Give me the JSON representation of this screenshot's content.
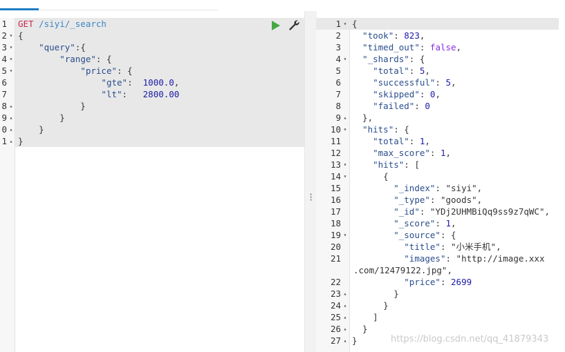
{
  "tab": {
    "underline_color": "#1a7cc4"
  },
  "request": {
    "lines": [
      {
        "n": "1",
        "fold": "",
        "tokens": [
          {
            "t": "GET",
            "c": "method"
          },
          {
            "t": " /siyi/_search",
            "c": "url"
          }
        ]
      },
      {
        "n": "2",
        "fold": "▾",
        "tokens": [
          {
            "t": "{",
            "c": "punc"
          }
        ]
      },
      {
        "n": "3",
        "fold": "▾",
        "tokens": [
          {
            "t": "    ",
            "c": "punc"
          },
          {
            "t": "\"query\"",
            "c": "key"
          },
          {
            "t": ":{",
            "c": "punc"
          }
        ]
      },
      {
        "n": "4",
        "fold": "▾",
        "tokens": [
          {
            "t": "        ",
            "c": "punc"
          },
          {
            "t": "\"range\"",
            "c": "key"
          },
          {
            "t": ": {",
            "c": "punc"
          }
        ]
      },
      {
        "n": "5",
        "fold": "▾",
        "tokens": [
          {
            "t": "            ",
            "c": "punc"
          },
          {
            "t": "\"price\"",
            "c": "key"
          },
          {
            "t": ": {",
            "c": "punc"
          }
        ]
      },
      {
        "n": "6",
        "fold": "",
        "tokens": [
          {
            "t": "                ",
            "c": "punc"
          },
          {
            "t": "\"gte\"",
            "c": "key"
          },
          {
            "t": ":  ",
            "c": "punc"
          },
          {
            "t": "1000.0",
            "c": "num"
          },
          {
            "t": ",",
            "c": "punc"
          }
        ]
      },
      {
        "n": "7",
        "fold": "",
        "tokens": [
          {
            "t": "                ",
            "c": "punc"
          },
          {
            "t": "\"lt\"",
            "c": "key"
          },
          {
            "t": ":   ",
            "c": "punc"
          },
          {
            "t": "2800.00",
            "c": "num"
          }
        ]
      },
      {
        "n": "8",
        "fold": "▴",
        "tokens": [
          {
            "t": "            }",
            "c": "punc"
          }
        ]
      },
      {
        "n": "9",
        "fold": "▴",
        "tokens": [
          {
            "t": "        }",
            "c": "punc"
          }
        ]
      },
      {
        "n": "0",
        "fold": "▴",
        "tokens": [
          {
            "t": "    }",
            "c": "punc"
          }
        ]
      },
      {
        "n": "1",
        "fold": "▴",
        "tokens": [
          {
            "t": "}",
            "c": "punc"
          }
        ]
      }
    ]
  },
  "response": {
    "lines": [
      {
        "n": "1",
        "fold": "▾",
        "tokens": [
          {
            "t": "{",
            "c": "punc"
          }
        ]
      },
      {
        "n": "2",
        "fold": "",
        "tokens": [
          {
            "t": "  ",
            "c": "punc"
          },
          {
            "t": "\"took\"",
            "c": "key"
          },
          {
            "t": ": ",
            "c": "punc"
          },
          {
            "t": "823",
            "c": "num"
          },
          {
            "t": ",",
            "c": "punc"
          }
        ]
      },
      {
        "n": "3",
        "fold": "",
        "tokens": [
          {
            "t": "  ",
            "c": "punc"
          },
          {
            "t": "\"timed_out\"",
            "c": "key"
          },
          {
            "t": ": ",
            "c": "punc"
          },
          {
            "t": "false",
            "c": "bool"
          },
          {
            "t": ",",
            "c": "punc"
          }
        ]
      },
      {
        "n": "4",
        "fold": "▾",
        "tokens": [
          {
            "t": "  ",
            "c": "punc"
          },
          {
            "t": "\"_shards\"",
            "c": "key"
          },
          {
            "t": ": {",
            "c": "punc"
          }
        ]
      },
      {
        "n": "5",
        "fold": "",
        "tokens": [
          {
            "t": "    ",
            "c": "punc"
          },
          {
            "t": "\"total\"",
            "c": "key"
          },
          {
            "t": ": ",
            "c": "punc"
          },
          {
            "t": "5",
            "c": "num"
          },
          {
            "t": ",",
            "c": "punc"
          }
        ]
      },
      {
        "n": "6",
        "fold": "",
        "tokens": [
          {
            "t": "    ",
            "c": "punc"
          },
          {
            "t": "\"successful\"",
            "c": "key"
          },
          {
            "t": ": ",
            "c": "punc"
          },
          {
            "t": "5",
            "c": "num"
          },
          {
            "t": ",",
            "c": "punc"
          }
        ]
      },
      {
        "n": "7",
        "fold": "",
        "tokens": [
          {
            "t": "    ",
            "c": "punc"
          },
          {
            "t": "\"skipped\"",
            "c": "key"
          },
          {
            "t": ": ",
            "c": "punc"
          },
          {
            "t": "0",
            "c": "num"
          },
          {
            "t": ",",
            "c": "punc"
          }
        ]
      },
      {
        "n": "8",
        "fold": "",
        "tokens": [
          {
            "t": "    ",
            "c": "punc"
          },
          {
            "t": "\"failed\"",
            "c": "key"
          },
          {
            "t": ": ",
            "c": "punc"
          },
          {
            "t": "0",
            "c": "num"
          }
        ]
      },
      {
        "n": "9",
        "fold": "▴",
        "tokens": [
          {
            "t": "  },",
            "c": "punc"
          }
        ]
      },
      {
        "n": "10",
        "fold": "▾",
        "tokens": [
          {
            "t": "  ",
            "c": "punc"
          },
          {
            "t": "\"hits\"",
            "c": "key"
          },
          {
            "t": ": {",
            "c": "punc"
          }
        ]
      },
      {
        "n": "11",
        "fold": "",
        "tokens": [
          {
            "t": "    ",
            "c": "punc"
          },
          {
            "t": "\"total\"",
            "c": "key"
          },
          {
            "t": ": ",
            "c": "punc"
          },
          {
            "t": "1",
            "c": "num"
          },
          {
            "t": ",",
            "c": "punc"
          }
        ]
      },
      {
        "n": "12",
        "fold": "",
        "tokens": [
          {
            "t": "    ",
            "c": "punc"
          },
          {
            "t": "\"max_score\"",
            "c": "key"
          },
          {
            "t": ": ",
            "c": "punc"
          },
          {
            "t": "1",
            "c": "num"
          },
          {
            "t": ",",
            "c": "punc"
          }
        ]
      },
      {
        "n": "13",
        "fold": "▾",
        "tokens": [
          {
            "t": "    ",
            "c": "punc"
          },
          {
            "t": "\"hits\"",
            "c": "key"
          },
          {
            "t": ": [",
            "c": "punc"
          }
        ]
      },
      {
        "n": "14",
        "fold": "▾",
        "tokens": [
          {
            "t": "      {",
            "c": "punc"
          }
        ]
      },
      {
        "n": "15",
        "fold": "",
        "tokens": [
          {
            "t": "        ",
            "c": "punc"
          },
          {
            "t": "\"_index\"",
            "c": "key"
          },
          {
            "t": ": ",
            "c": "punc"
          },
          {
            "t": "\"siyi\"",
            "c": "str"
          },
          {
            "t": ",",
            "c": "punc"
          }
        ]
      },
      {
        "n": "16",
        "fold": "",
        "tokens": [
          {
            "t": "        ",
            "c": "punc"
          },
          {
            "t": "\"_type\"",
            "c": "key"
          },
          {
            "t": ": ",
            "c": "punc"
          },
          {
            "t": "\"goods\"",
            "c": "str"
          },
          {
            "t": ",",
            "c": "punc"
          }
        ]
      },
      {
        "n": "17",
        "fold": "",
        "tokens": [
          {
            "t": "        ",
            "c": "punc"
          },
          {
            "t": "\"_id\"",
            "c": "key"
          },
          {
            "t": ": ",
            "c": "punc"
          },
          {
            "t": "\"YDj2UHMBiQq9ss9z7qWC\"",
            "c": "str"
          },
          {
            "t": ",",
            "c": "punc"
          }
        ]
      },
      {
        "n": "18",
        "fold": "",
        "tokens": [
          {
            "t": "        ",
            "c": "punc"
          },
          {
            "t": "\"_score\"",
            "c": "key"
          },
          {
            "t": ": ",
            "c": "punc"
          },
          {
            "t": "1",
            "c": "num"
          },
          {
            "t": ",",
            "c": "punc"
          }
        ]
      },
      {
        "n": "19",
        "fold": "▾",
        "tokens": [
          {
            "t": "        ",
            "c": "punc"
          },
          {
            "t": "\"_source\"",
            "c": "key"
          },
          {
            "t": ": {",
            "c": "punc"
          }
        ]
      },
      {
        "n": "20",
        "fold": "",
        "tokens": [
          {
            "t": "          ",
            "c": "punc"
          },
          {
            "t": "\"title\"",
            "c": "key"
          },
          {
            "t": ": ",
            "c": "punc"
          },
          {
            "t": "\"小米手机\"",
            "c": "str"
          },
          {
            "t": ",",
            "c": "punc"
          }
        ]
      },
      {
        "n": "21",
        "fold": "",
        "tokens": [
          {
            "t": "          ",
            "c": "punc"
          },
          {
            "t": "\"images\"",
            "c": "key"
          },
          {
            "t": ": ",
            "c": "punc"
          },
          {
            "t": "\"http://image.xxx",
            "c": "str"
          }
        ]
      },
      {
        "n": "",
        "fold": "",
        "wrap": true,
        "tokens": [
          {
            "t": ".com/12479122.jpg\"",
            "c": "str"
          },
          {
            "t": ",",
            "c": "punc"
          }
        ]
      },
      {
        "n": "22",
        "fold": "",
        "tokens": [
          {
            "t": "          ",
            "c": "punc"
          },
          {
            "t": "\"price\"",
            "c": "key"
          },
          {
            "t": ": ",
            "c": "punc"
          },
          {
            "t": "2699",
            "c": "num"
          }
        ]
      },
      {
        "n": "23",
        "fold": "▴",
        "tokens": [
          {
            "t": "        }",
            "c": "punc"
          }
        ]
      },
      {
        "n": "24",
        "fold": "▴",
        "tokens": [
          {
            "t": "      }",
            "c": "punc"
          }
        ]
      },
      {
        "n": "25",
        "fold": "▴",
        "tokens": [
          {
            "t": "    ]",
            "c": "punc"
          }
        ]
      },
      {
        "n": "26",
        "fold": "▴",
        "tokens": [
          {
            "t": "  }",
            "c": "punc"
          }
        ]
      },
      {
        "n": "27",
        "fold": "▴",
        "tokens": [
          {
            "t": "}",
            "c": "punc"
          }
        ]
      }
    ]
  },
  "watermark": "https://blog.csdn.net/qq_41879343",
  "colors": {
    "run": "#43a843",
    "highlight": "#e8e8e8"
  }
}
